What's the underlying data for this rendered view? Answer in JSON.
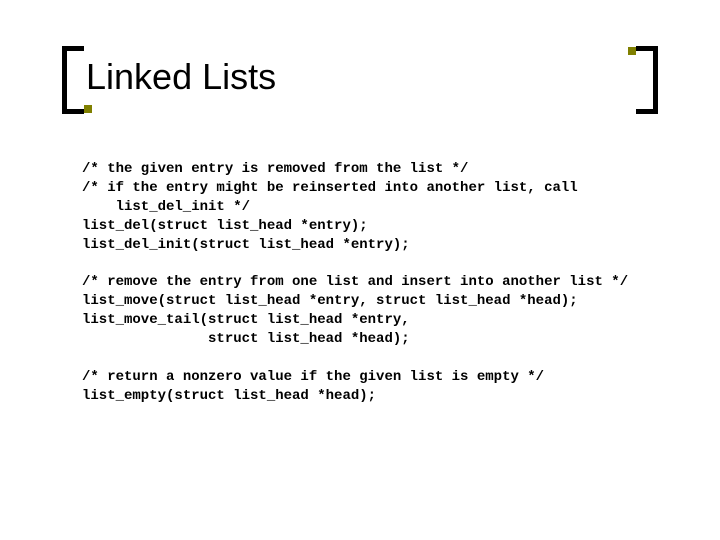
{
  "title": "Linked Lists",
  "code": {
    "l1": "/* the given entry is removed from the list */",
    "l2": "/* if the entry might be reinserted into another list, call list_del_init */",
    "l3": "list_del(struct list_head *entry);",
    "l4": "list_del_init(struct list_head *entry);",
    "l5": "/* remove the entry from one list and insert into another list */",
    "l6": "list_move(struct list_head *entry, struct list_head *head);",
    "l7": "list_move_tail(struct list_head *entry,",
    "l8": "struct list_head *head);",
    "l9": "/* return a nonzero value if the given list is empty */",
    "l10": "list_empty(struct list_head *head);"
  }
}
